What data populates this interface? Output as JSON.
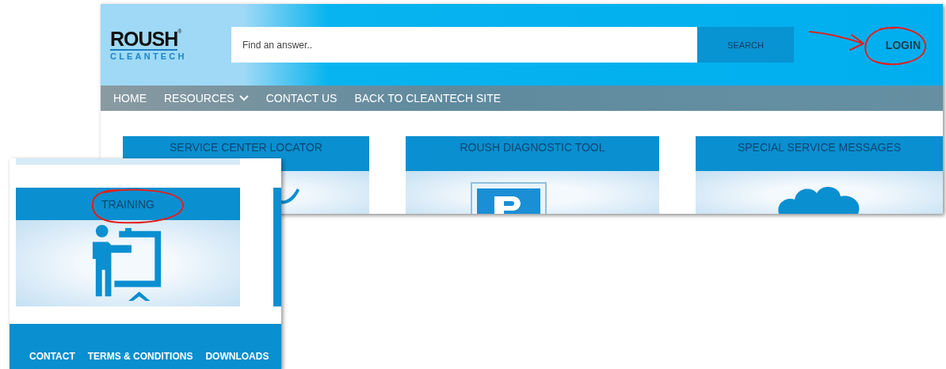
{
  "logo": {
    "name": "ROUSH",
    "registered": "®",
    "tagline": "CLEANTECH"
  },
  "search": {
    "placeholder": "Find an answer..",
    "button": "SEARCH"
  },
  "login": {
    "label": "LOGIN",
    "circled": true,
    "arrow": true
  },
  "nav": [
    {
      "label": "HOME",
      "dropdown": false
    },
    {
      "label": "RESOURCES",
      "dropdown": true
    },
    {
      "label": "CONTACT US",
      "dropdown": false
    },
    {
      "label": "BACK TO CLEANTECH SITE",
      "dropdown": false
    }
  ],
  "tiles": [
    {
      "title": "SERVICE CENTER LOCATOR",
      "kind": "locator"
    },
    {
      "title": "ROUSH DIAGNOSTIC TOOL",
      "kind": "diagnostic"
    },
    {
      "title": "SPECIAL SERVICE MESSAGES",
      "kind": "messages"
    }
  ],
  "inset": {
    "tile": {
      "title": "TRAINING",
      "kind": "training",
      "circled": true
    },
    "footer_links": [
      "CONTACT",
      "TERMS & CONDITIONS",
      "DOWNLOADS"
    ]
  }
}
